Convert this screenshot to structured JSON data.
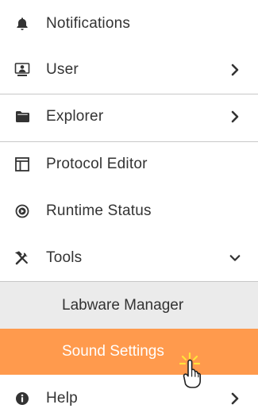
{
  "menu": {
    "items": [
      {
        "label": "Notifications",
        "icon": "bell-icon"
      },
      {
        "label": "User",
        "icon": "user-monitor-icon",
        "chevron": "right"
      },
      {
        "label": "Explorer",
        "icon": "folder-icon",
        "chevron": "right"
      },
      {
        "label": "Protocol Editor",
        "icon": "layout-icon"
      },
      {
        "label": "Runtime Status",
        "icon": "play-circle-icon"
      },
      {
        "label": "Tools",
        "icon": "tools-icon",
        "chevron": "down"
      },
      {
        "label": "Help",
        "icon": "info-icon",
        "chevron": "right"
      }
    ],
    "tools_submenu": [
      {
        "label": "Labware Manager"
      },
      {
        "label": "Sound Settings",
        "active": true
      }
    ]
  },
  "colors": {
    "active_bg": "#ff9a4d",
    "submenu_bg": "#ebebeb",
    "text": "#333333",
    "divider": "#c8c8c8"
  },
  "cursor": {
    "icon": "hand-pointer-icon"
  }
}
